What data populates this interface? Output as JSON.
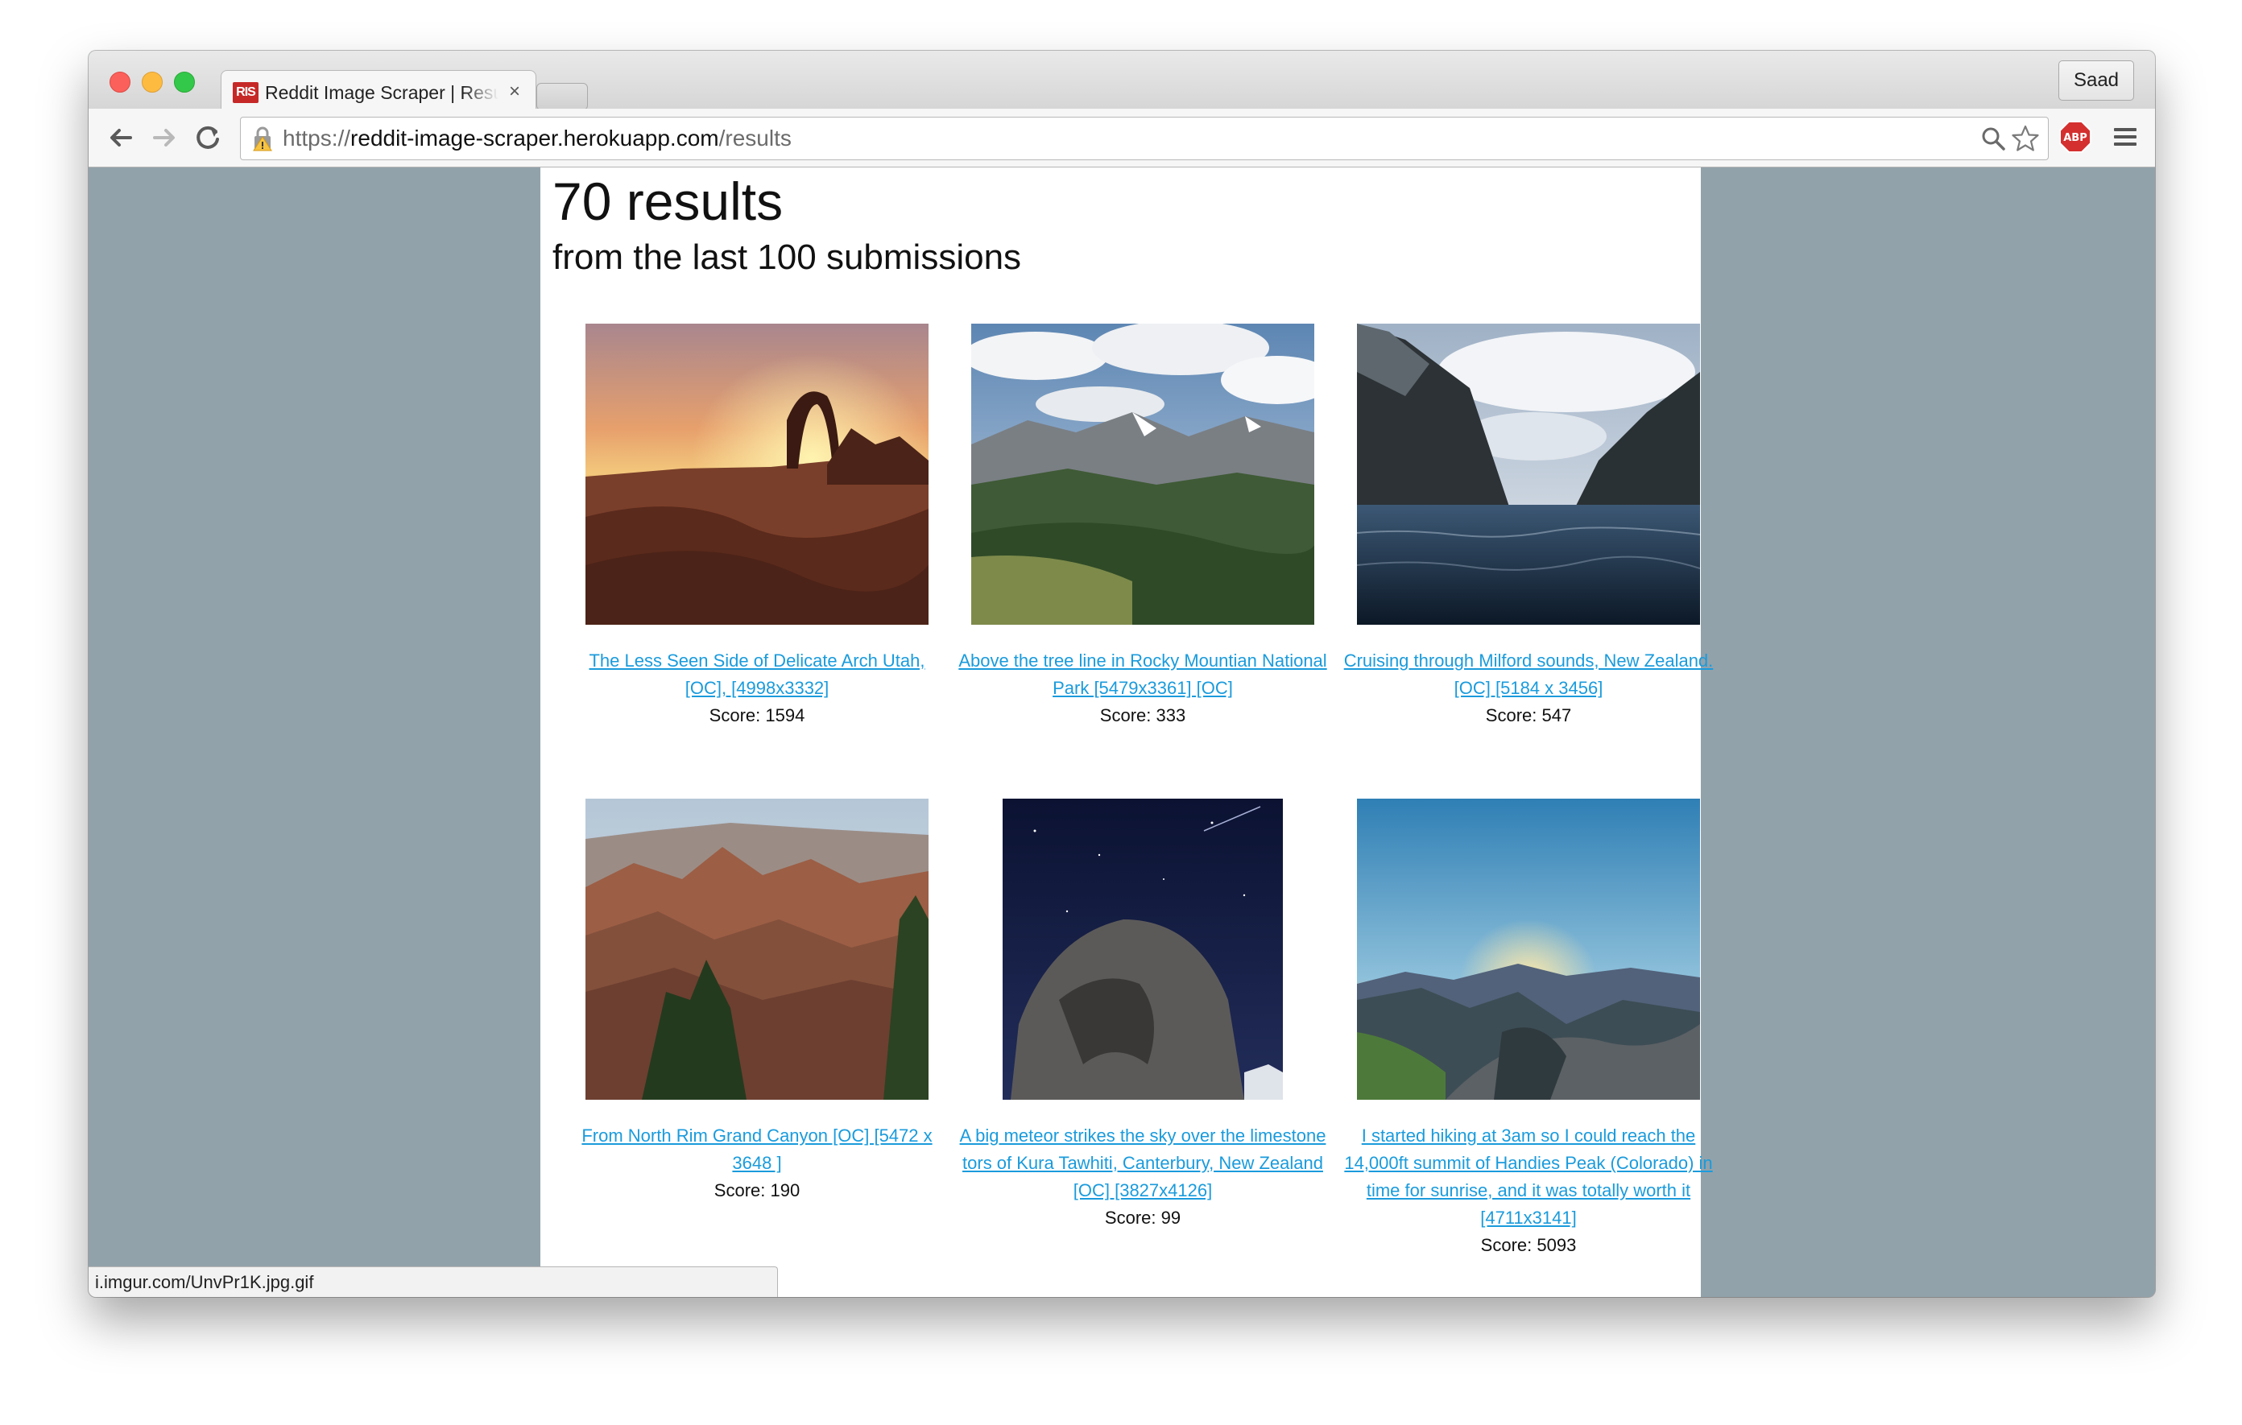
{
  "browser": {
    "tab_title": "Reddit Image Scraper | Results",
    "tab_favicon_text": "RIS",
    "tab_close": "×",
    "profile_name": "Saad",
    "url_scheme": "https://",
    "url_host": "reddit-image-scraper.herokuapp.com",
    "url_path": "/results",
    "status_url": "i.imgur.com/UnvPr1K.jpg.gif",
    "icons": [
      "back-arrow-icon",
      "forward-arrow-icon",
      "reload-icon",
      "lock-warning-icon",
      "search-icon",
      "star-icon",
      "adblock-plus-icon",
      "hamburger-menu-icon"
    ]
  },
  "page": {
    "title": "70 results",
    "subtitle": "from the last 100 submissions"
  },
  "results": [
    {
      "caption": "The Less Seen Side of Delicate Arch Utah, [OC], [4998x3332]",
      "score": "Score: 1594",
      "scene": "desert-arch-sunset"
    },
    {
      "caption": "Above the tree line in Rocky Mountian National Park [5479x3361] [OC]",
      "score": "Score: 333",
      "scene": "mountain-valley"
    },
    {
      "caption": "Cruising through Milford sounds, New Zealand. [OC] [5184 x 3456]",
      "score": "Score: 547",
      "scene": "fjord-water"
    },
    {
      "caption": "From North Rim Grand Canyon [OC] [5472 x 3648 ]",
      "score": "Score: 190",
      "scene": "canyon"
    },
    {
      "caption": "A big meteor strikes the sky over the limestone tors of Kura Tawhiti, Canterbury, New Zealand [OC] [3827x4126]",
      "score": "Score: 99",
      "scene": "night-rock"
    },
    {
      "caption": "I started hiking at 3am so I could reach the 14,000ft summit of Handies Peak (Colorado) in time for sunrise, and it was totally worth it [4711x3141]",
      "score": "Score: 5093",
      "scene": "summit-sunrise"
    }
  ]
}
